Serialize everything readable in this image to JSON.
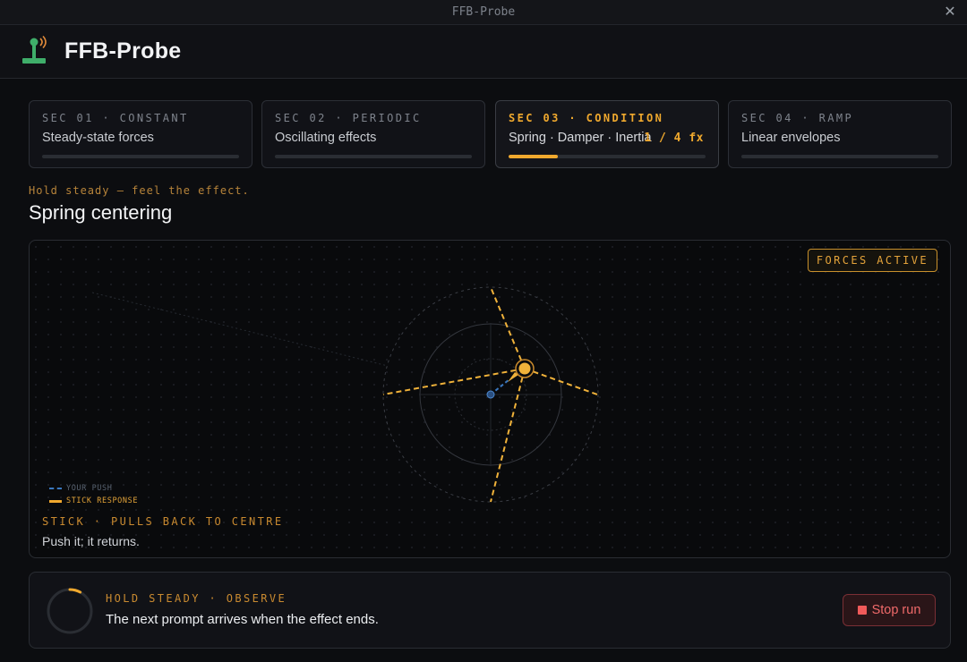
{
  "window": {
    "title": "FFB-Probe"
  },
  "app": {
    "name": "FFB-Probe",
    "logo_icon": "joystick-signal-icon",
    "accent": "#f0a92e"
  },
  "sections": [
    {
      "tag": "SEC 01 · CONSTANT",
      "name": "Steady-state forces",
      "progress": 0,
      "active": false
    },
    {
      "tag": "SEC 02 · PERIODIC",
      "name": "Oscillating effects",
      "progress": 0,
      "active": false
    },
    {
      "tag": "SEC 03 · CONDITION",
      "name": "Spring · Damper · Inertia",
      "count": "1 / 4 fx",
      "progress": 0.25,
      "active": true
    },
    {
      "tag": "SEC 04 · RAMP",
      "name": "Linear envelopes",
      "progress": 0,
      "active": false
    }
  ],
  "prompt": "Hold steady — feel the effect.",
  "heading": "Spring centering",
  "stage": {
    "badge": "FORCES ACTIVE",
    "legend": {
      "push": "YOUR PUSH",
      "response": "STICK RESPONSE"
    },
    "caption": "STICK · PULLS BACK TO CENTRE",
    "sub": "Push it; it returns."
  },
  "status": {
    "phase": "HOLD STEADY · OBSERVE",
    "message": "The next prompt arrives when the effect ends.",
    "progress": 0.08,
    "stop_label": "Stop run",
    "stop_color": "#f06a6a"
  }
}
